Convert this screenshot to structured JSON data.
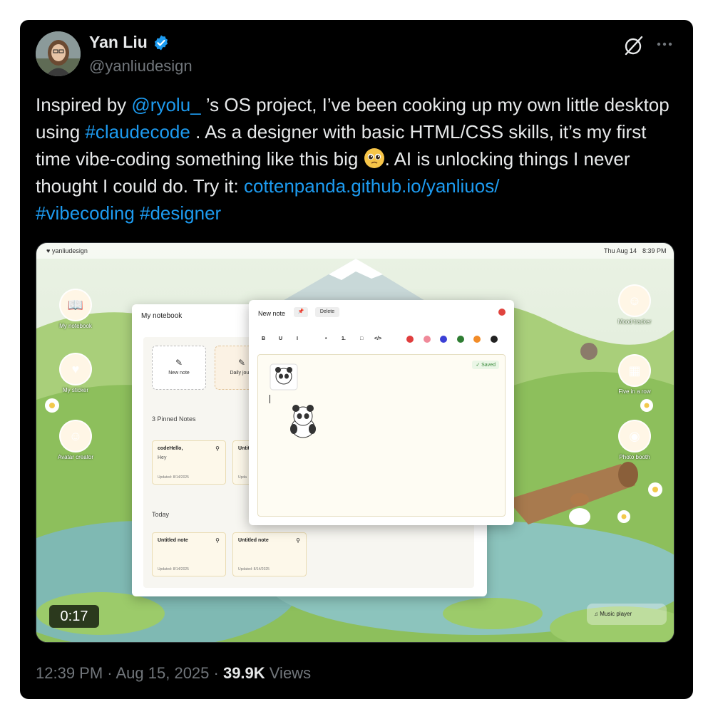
{
  "tweet": {
    "author_name": "Yan Liu",
    "handle": "@yanliudesign",
    "text_parts": {
      "p1": "Inspired by ",
      "mention": "@ryolu_",
      "p2": " ’s OS project, I’ve been cooking up my own little desktop using ",
      "hashtag1": "#claudecode",
      "p3": " . As a designer with basic HTML/CSS skills, it’s my first time vibe-coding something like this big ",
      "p4": ". AI is unlocking things I never thought I could do. Try it: ",
      "url": "cottenpanda.github.io/yanliuos/",
      "hashtag2": "#vibecoding",
      "hashtag3": "#designer"
    },
    "timestamp": "12:39 PM · Aug 15, 2025 · ",
    "views_count": "39.9K",
    "views_label": " Views",
    "icons": {
      "verified": "verified-badge-icon",
      "grok": "grok-icon",
      "more": "more-icon",
      "emoji": "pleading-face-emoji"
    },
    "colors": {
      "link": "#1d9bf0",
      "background": "#000000",
      "text": "#e7e9ea",
      "muted": "#71767b",
      "verified": "#1d9bf0"
    }
  },
  "media": {
    "duration": "0:17",
    "menubar": {
      "brand": "♥ yanliudesign",
      "date": "Thu Aug 14",
      "time": "8:39 PM"
    },
    "desktop_icons": {
      "notebook": "My notebook",
      "sticker": "My sticker",
      "avatar": "Avatar creator",
      "mood": "Mood tracker",
      "five": "Five in a row",
      "photo": "Photo booth"
    },
    "notebook": {
      "title": "My notebook",
      "new_note": "New note",
      "daily_journal": "Daily journ",
      "pinned_label": "3 Pinned Notes",
      "today_label": "Today",
      "pinned_notes": [
        {
          "title": "codeHello,",
          "body": "Hey",
          "updated": "Updated: 8/14/2025"
        },
        {
          "title": "Untit",
          "body": "",
          "updated": "Upda"
        }
      ],
      "today_notes": [
        {
          "title": "Untitled note",
          "updated": "Updated: 8/14/2025"
        },
        {
          "title": "Untitled note",
          "updated": "Updated: 8/14/2025"
        }
      ]
    },
    "editor": {
      "title": "New note",
      "pin": "📌",
      "delete": "Delete",
      "toolbar": [
        "B",
        "U",
        "I",
        "•",
        "1.",
        "□",
        "</>"
      ],
      "swatches": [
        "#e03e3e",
        "#f08a9a",
        "#3b3fd6",
        "#2e7d32",
        "#f28c28",
        "#222222"
      ],
      "saved": "✓ Saved"
    },
    "music_player": "♫  Music player"
  }
}
